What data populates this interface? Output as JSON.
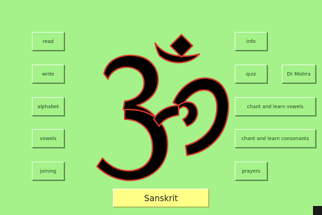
{
  "left_menu": [
    {
      "label": "read"
    },
    {
      "label": "write"
    },
    {
      "label": "alphabet"
    },
    {
      "label": "vowels"
    },
    {
      "label": "joining"
    }
  ],
  "right_menu": {
    "info": "info",
    "quiz": "quiz",
    "dr_mishra": "Dr Mishra",
    "chant_vowels": "chant and learn vowels",
    "chant_consonants": "chant and learn consonants",
    "prayers": "prayers"
  },
  "title": "Sanskrit",
  "colors": {
    "background": "#a6f28a",
    "title_bg": "#ffff88",
    "symbol_fill": "#000000",
    "symbol_outline": "#d83a2a"
  },
  "symbol_icon": "om-symbol"
}
